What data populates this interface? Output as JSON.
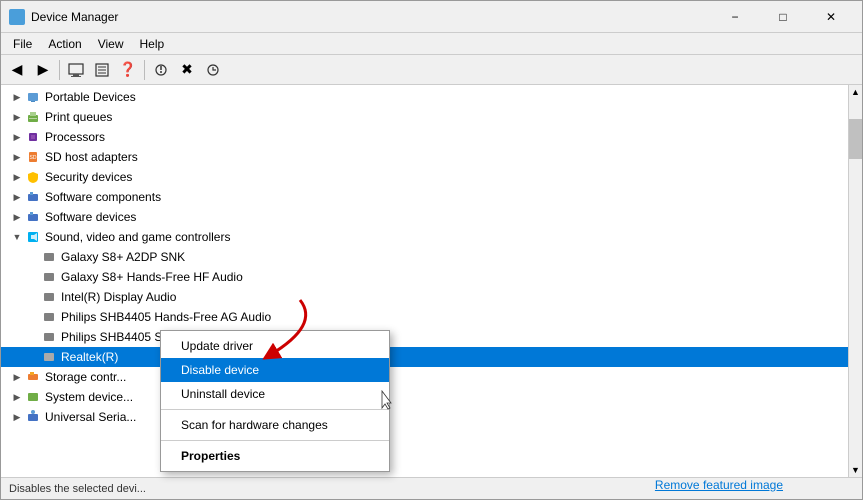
{
  "window": {
    "title": "Device Manager",
    "icon": "🖥"
  },
  "titlebar": {
    "minimize": "−",
    "maximize": "□",
    "close": "✕"
  },
  "menubar": {
    "items": [
      "File",
      "Action",
      "View",
      "Help"
    ]
  },
  "toolbar": {
    "buttons": [
      "◀",
      "▶",
      "🖥",
      "📋",
      "❓",
      "⚙",
      "✖",
      "⬇"
    ]
  },
  "tree": {
    "items": [
      {
        "label": "Portable Devices",
        "indent": 0,
        "has_toggle": true,
        "expanded": false,
        "icon": "portable"
      },
      {
        "label": "Print queues",
        "indent": 0,
        "has_toggle": true,
        "expanded": false,
        "icon": "printer"
      },
      {
        "label": "Processors",
        "indent": 0,
        "has_toggle": true,
        "expanded": false,
        "icon": "processor"
      },
      {
        "label": "SD host adapters",
        "indent": 0,
        "has_toggle": true,
        "expanded": false,
        "icon": "sd"
      },
      {
        "label": "Security devices",
        "indent": 0,
        "has_toggle": true,
        "expanded": false,
        "icon": "security"
      },
      {
        "label": "Software components",
        "indent": 0,
        "has_toggle": true,
        "expanded": false,
        "icon": "software"
      },
      {
        "label": "Software devices",
        "indent": 0,
        "has_toggle": true,
        "expanded": false,
        "icon": "software"
      },
      {
        "label": "Sound, video and game controllers",
        "indent": 0,
        "has_toggle": true,
        "expanded": true,
        "icon": "sound"
      },
      {
        "label": "Galaxy S8+ A2DP SNK",
        "indent": 1,
        "has_toggle": false,
        "expanded": false,
        "icon": "audio"
      },
      {
        "label": "Galaxy S8+ Hands-Free HF Audio",
        "indent": 1,
        "has_toggle": false,
        "expanded": false,
        "icon": "audio"
      },
      {
        "label": "Intel(R) Display Audio",
        "indent": 1,
        "has_toggle": false,
        "expanded": false,
        "icon": "audio"
      },
      {
        "label": "Philips SHB4405 Hands-Free AG Audio",
        "indent": 1,
        "has_toggle": false,
        "expanded": false,
        "icon": "audio"
      },
      {
        "label": "Philips SHB4405 Stereo",
        "indent": 1,
        "has_toggle": false,
        "expanded": false,
        "icon": "audio"
      },
      {
        "label": "Realtek(R)",
        "indent": 1,
        "has_toggle": false,
        "expanded": false,
        "icon": "audio",
        "selected": true
      },
      {
        "label": "Storage contr...",
        "indent": 0,
        "has_toggle": true,
        "expanded": false,
        "icon": "storage"
      },
      {
        "label": "System device...",
        "indent": 0,
        "has_toggle": true,
        "expanded": false,
        "icon": "system"
      },
      {
        "label": "Universal Seria...",
        "indent": 0,
        "has_toggle": true,
        "expanded": false,
        "icon": "universal"
      }
    ]
  },
  "context_menu": {
    "items": [
      {
        "label": "Update driver",
        "type": "normal"
      },
      {
        "label": "Disable device",
        "type": "active"
      },
      {
        "label": "Uninstall device",
        "type": "normal"
      },
      {
        "label": "separator",
        "type": "separator"
      },
      {
        "label": "Scan for hardware changes",
        "type": "normal"
      },
      {
        "label": "separator2",
        "type": "separator"
      },
      {
        "label": "Properties",
        "type": "bold"
      }
    ]
  },
  "status_bar": {
    "text": "Disables the selected devi..."
  },
  "remove_link": {
    "label": "Remove featured image"
  }
}
